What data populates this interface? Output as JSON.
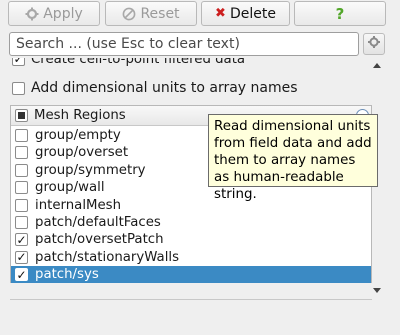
{
  "toolbar": {
    "apply_label": "Apply",
    "reset_label": "Reset",
    "delete_label": "Delete",
    "help_label": "?"
  },
  "search": {
    "placeholder": "Search ... (use Esc to clear text)"
  },
  "options": [
    {
      "label": "Create cell-to-point filtered data",
      "checked": true
    },
    {
      "label": "Add dimensional units to array names",
      "checked": false
    }
  ],
  "mesh_regions": {
    "header": "Mesh Regions",
    "items": [
      {
        "label": "group/empty",
        "checked": false,
        "selected": false
      },
      {
        "label": "group/overset",
        "checked": false,
        "selected": false
      },
      {
        "label": "group/symmetry",
        "checked": false,
        "selected": false
      },
      {
        "label": "group/wall",
        "checked": false,
        "selected": false
      },
      {
        "label": "internalMesh",
        "checked": false,
        "selected": false
      },
      {
        "label": "patch/defaultFaces",
        "checked": false,
        "selected": false
      },
      {
        "label": "patch/oversetPatch",
        "checked": true,
        "selected": false
      },
      {
        "label": "patch/stationaryWalls",
        "checked": true,
        "selected": false
      },
      {
        "label": "patch/sys",
        "checked": true,
        "selected": true
      }
    ]
  },
  "tooltip": {
    "text": "Read dimensional units from field data and add them to array names as human-readable string."
  },
  "colors": {
    "selection": "#3b8ac4",
    "tooltip_bg": "#ffffdc",
    "delete_icon": "#cc1f1f",
    "help_icon": "#52a629"
  }
}
